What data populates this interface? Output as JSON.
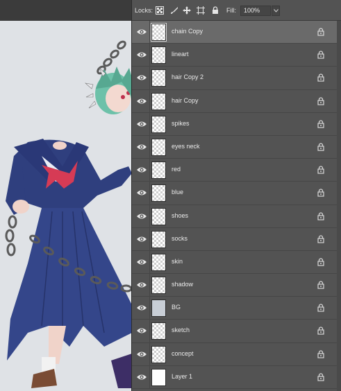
{
  "toolbar": {
    "locks_label": "Locks:",
    "fill_label": "Fill:",
    "fill_value": "100%",
    "lock_icons": [
      "lock-transparent-pixels-icon",
      "lock-image-pixels-icon",
      "lock-position-icon",
      "lock-artboard-icon",
      "lock-all-icon"
    ]
  },
  "layers": [
    {
      "name": "chain Copy",
      "selected": true,
      "thumb": "checker"
    },
    {
      "name": "lineart",
      "selected": false,
      "thumb": "checker"
    },
    {
      "name": "hair Copy 2",
      "selected": false,
      "thumb": "checker"
    },
    {
      "name": "hair Copy",
      "selected": false,
      "thumb": "checker"
    },
    {
      "name": "spikes",
      "selected": false,
      "thumb": "checker"
    },
    {
      "name": "eyes neck",
      "selected": false,
      "thumb": "checker"
    },
    {
      "name": "red",
      "selected": false,
      "thumb": "checker"
    },
    {
      "name": "blue",
      "selected": false,
      "thumb": "checker"
    },
    {
      "name": "shoes",
      "selected": false,
      "thumb": "checker"
    },
    {
      "name": "socks",
      "selected": false,
      "thumb": "checker"
    },
    {
      "name": "skin",
      "selected": false,
      "thumb": "checker"
    },
    {
      "name": "shadow",
      "selected": false,
      "thumb": "checker"
    },
    {
      "name": "BG",
      "selected": false,
      "thumb": "solid-bg"
    },
    {
      "name": "sketch",
      "selected": false,
      "thumb": "checker"
    },
    {
      "name": "concept",
      "selected": false,
      "thumb": "checker"
    },
    {
      "name": "Layer 1",
      "selected": false,
      "thumb": "solid-white"
    }
  ],
  "colors": {
    "panel_bg": "#535353",
    "selected_row": "#6a6a6a",
    "canvas_bg": "#dfe2e6",
    "uniform_blue": "#2f3f7e",
    "scarf_red": "#d63b55",
    "hair_teal": "#6dc1a9"
  }
}
